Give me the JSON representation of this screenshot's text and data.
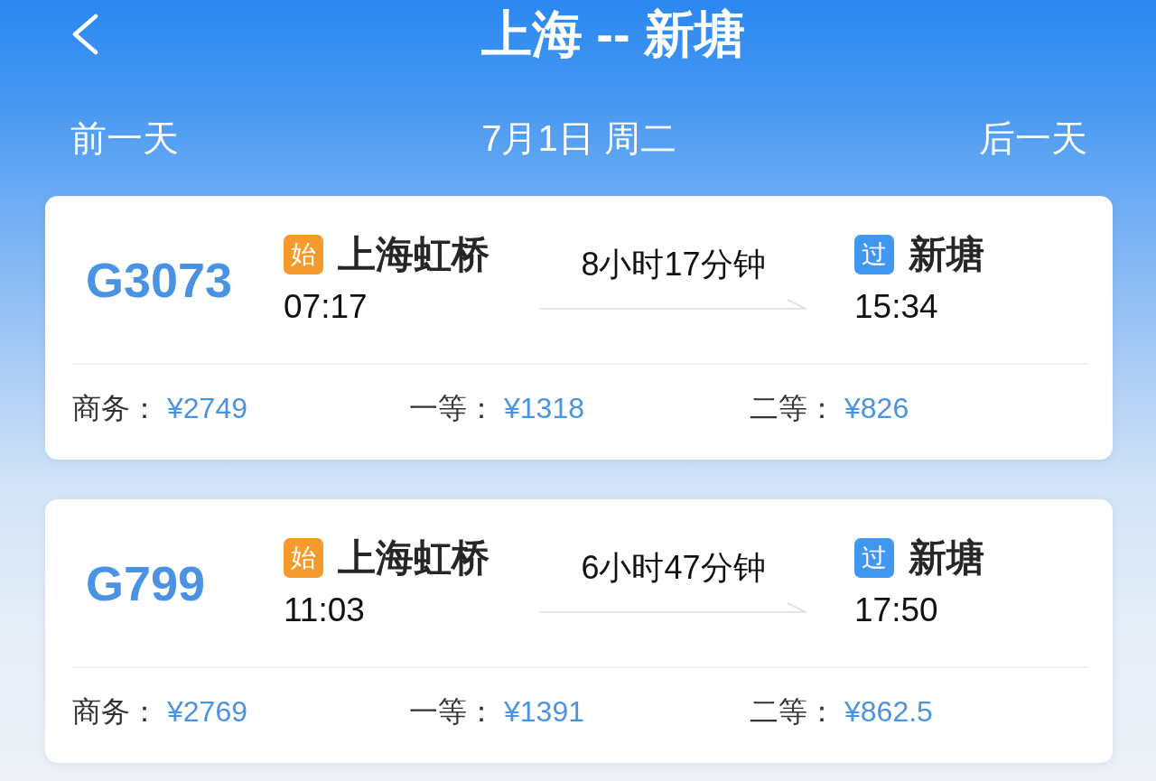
{
  "header": {
    "title": "上海 -- 新塘"
  },
  "date_bar": {
    "previous_day": "前一天",
    "date": "7月1日 周二",
    "next_day": "后一天"
  },
  "trains": [
    {
      "number": "G3073",
      "stops": [
        {
          "badge": "始",
          "color": "#f59a2c",
          "station": "上海虹桥",
          "time": "07:17"
        },
        {
          "badge": "过",
          "color": "#3f97f2",
          "station": "新塘",
          "time": "15:34"
        }
      ],
      "duration": "8小时17分钟",
      "prices": [
        {
          "label": "商务：",
          "price": "¥2749"
        },
        {
          "label": "一等：",
          "price": "¥1318"
        },
        {
          "label": "二等：",
          "price": "¥826"
        }
      ]
    },
    {
      "number": "G799",
      "stops": [
        {
          "badge": "始",
          "color": "#f59a2c",
          "station": "上海虹桥",
          "time": "11:03"
        },
        {
          "badge": "过",
          "color": "#3f97f2",
          "station": "新塘",
          "time": "17:50"
        }
      ],
      "duration": "6小时47分钟",
      "prices": [
        {
          "label": "商务：",
          "price": "¥2769"
        },
        {
          "label": "一等：",
          "price": "¥1391"
        },
        {
          "label": "二等：",
          "price": "¥862.5"
        }
      ]
    }
  ]
}
